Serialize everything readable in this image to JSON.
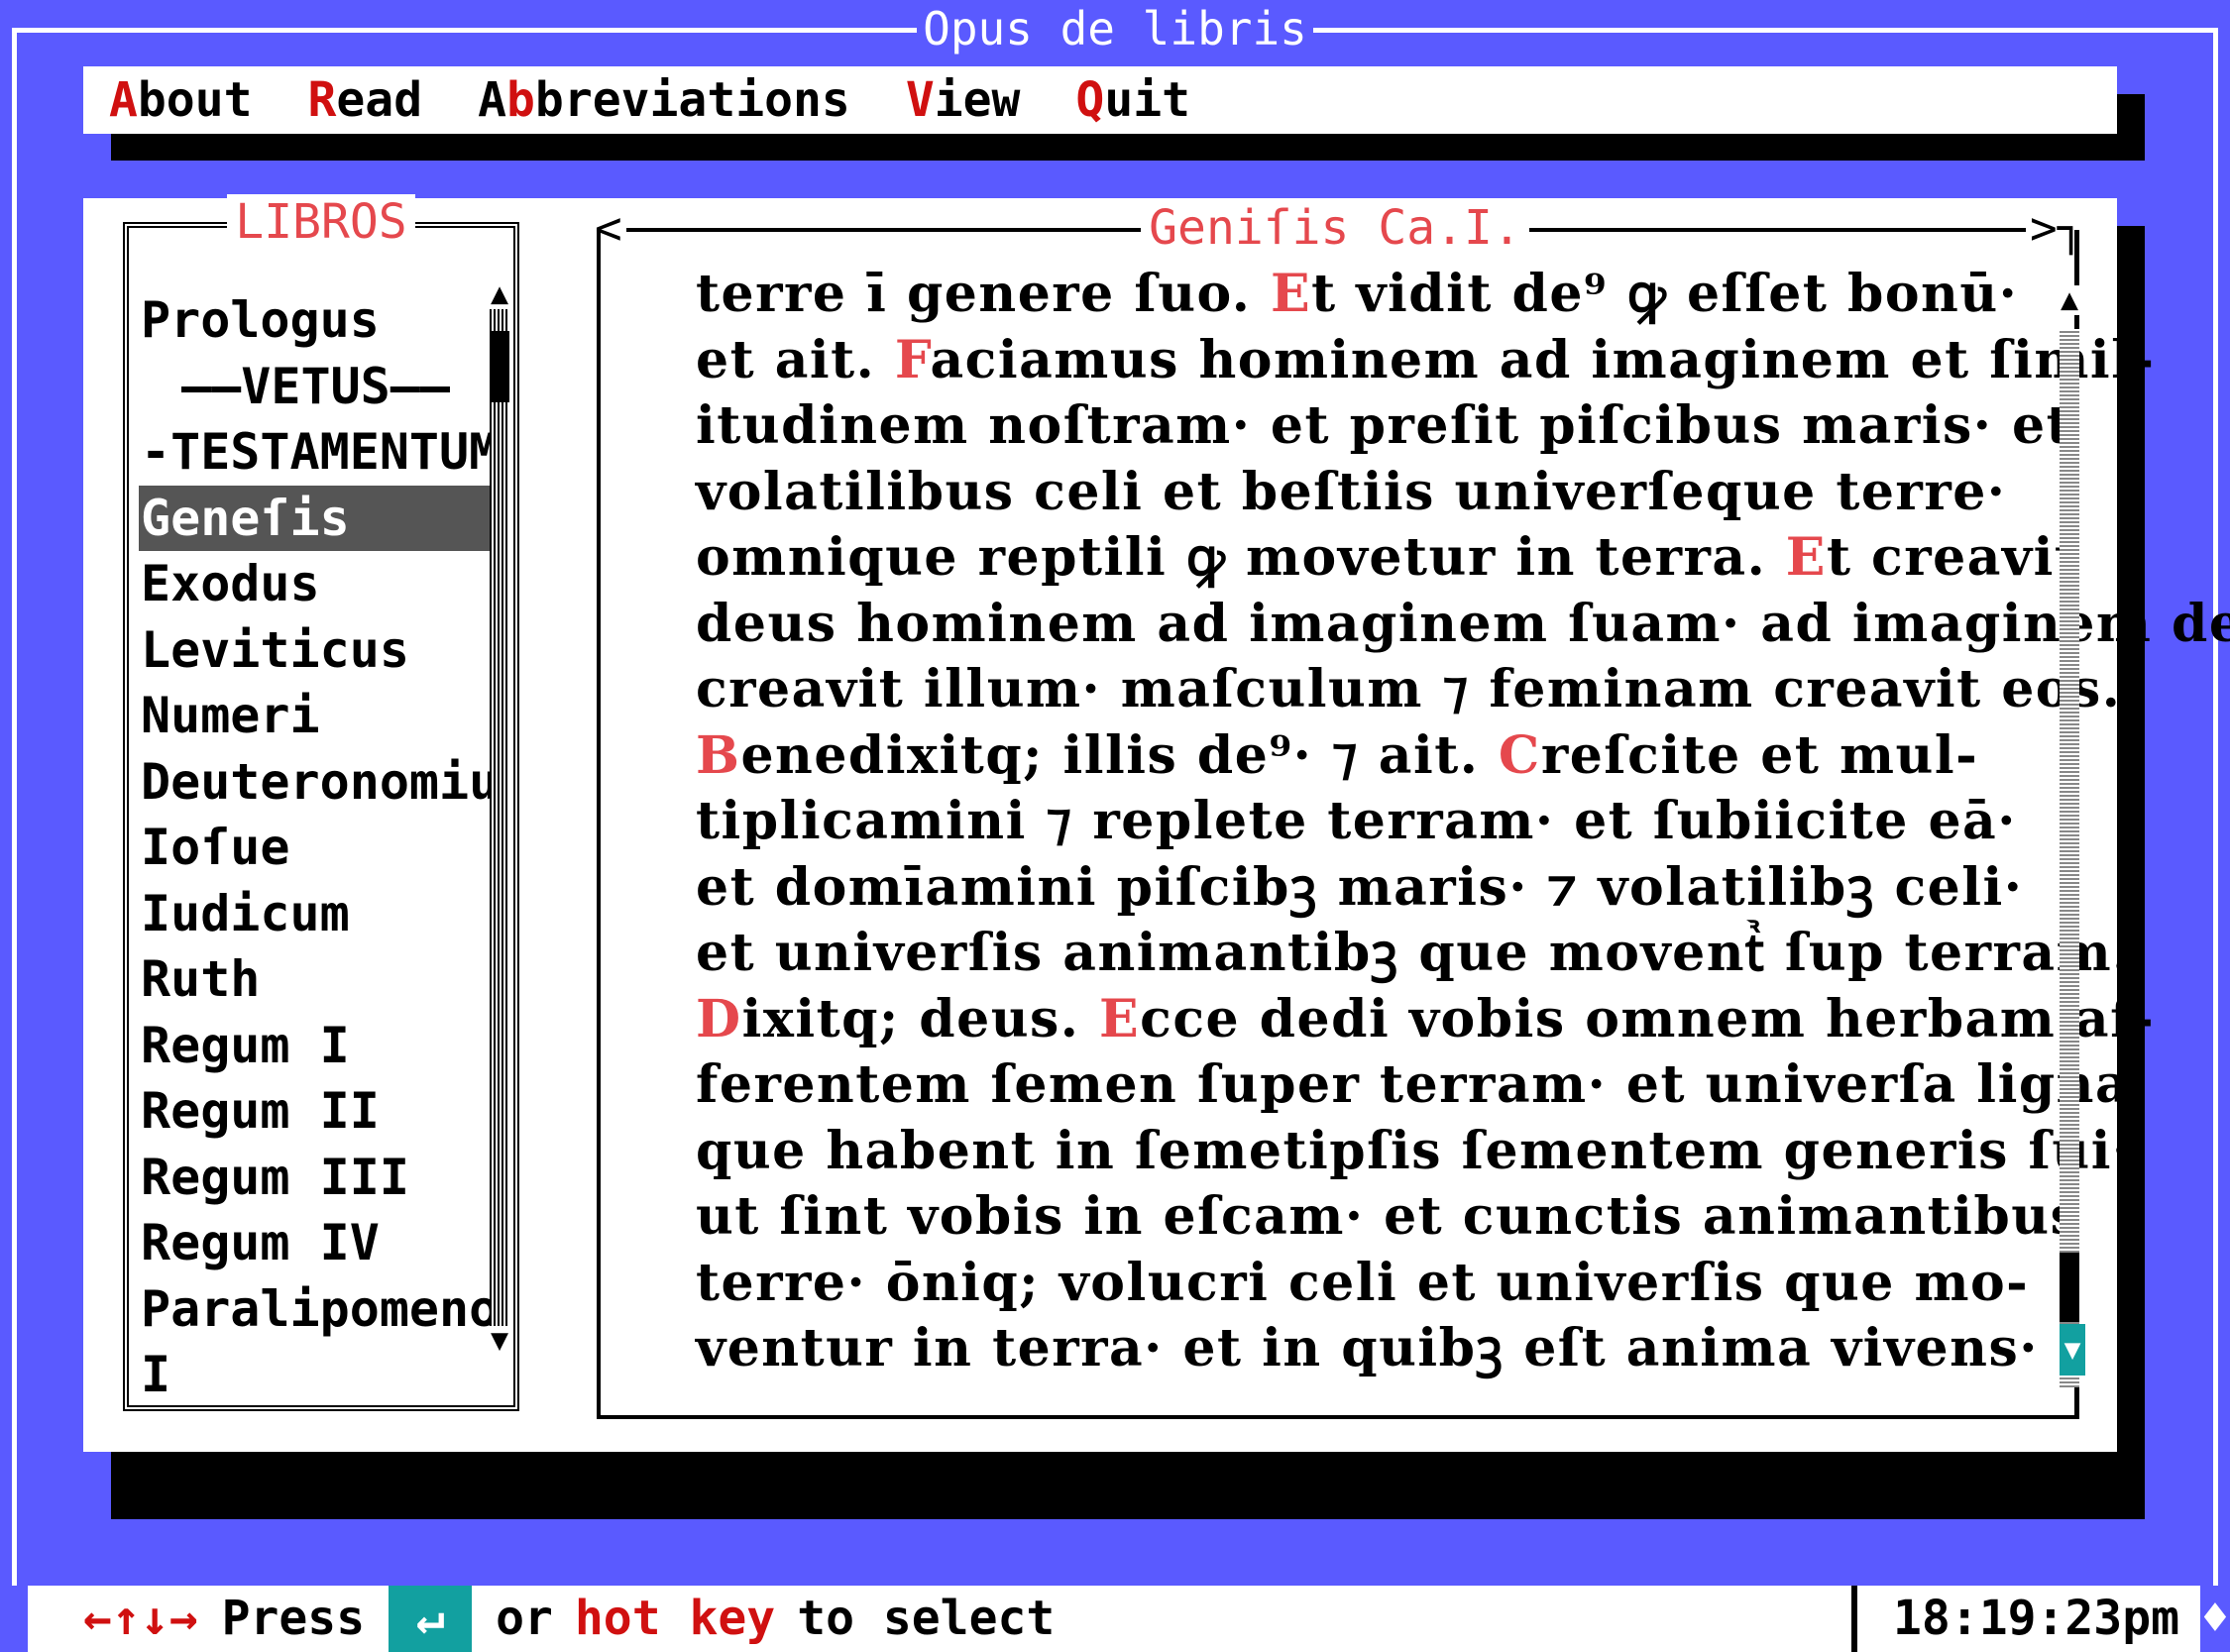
{
  "app_title": "Opus de libris",
  "menu": [
    {
      "hotkey": "A",
      "rest": "bout"
    },
    {
      "hotkey": "R",
      "rest": "ead"
    },
    {
      "prefix": "A",
      "hotkey": "b",
      "rest": "breviations"
    },
    {
      "hotkey": "V",
      "rest": "iew"
    },
    {
      "hotkey": "Q",
      "rest": "uit"
    }
  ],
  "books_panel": {
    "title": "LIBROS",
    "items": [
      {
        "label": "Prologus"
      },
      {
        "label": "——VETUS——",
        "center": true
      },
      {
        "label": "-TESTAMENTUM-",
        "center": true
      },
      {
        "label": "Geneſis",
        "selected": true
      },
      {
        "label": "Exodus"
      },
      {
        "label": "Leviticus"
      },
      {
        "label": "Numeri"
      },
      {
        "label": "Deuteronomium"
      },
      {
        "label": "Ioſue"
      },
      {
        "label": "Iudicum"
      },
      {
        "label": "Ruth"
      },
      {
        "label": "Regum I"
      },
      {
        "label": "Regum II"
      },
      {
        "label": "Regum III"
      },
      {
        "label": "Regum IV"
      },
      {
        "label": "Paralipomenon"
      },
      {
        "label": " I"
      }
    ]
  },
  "text_panel": {
    "title": "Geniſis Ca.I.",
    "lines": [
      [
        {
          "t": "terre ī genere ſuo. "
        },
        {
          "t": "E",
          "cap": true
        },
        {
          "t": "t vidit de⁹ ꝙ eſſet bonū·"
        }
      ],
      [
        {
          "t": "et ait. "
        },
        {
          "t": "F",
          "cap": true
        },
        {
          "t": "aciamus hominem ad imaginem et ſimil-"
        }
      ],
      [
        {
          "t": "itudinem noſtram· et preſit piſcibus maris· et"
        }
      ],
      [
        {
          "t": "volatilibus celi et beſtiis univerſeque terre·"
        }
      ],
      [
        {
          "t": "omnique reptili ꝙ movetur in terra. "
        },
        {
          "t": "E",
          "cap": true
        },
        {
          "t": "t creavit"
        }
      ],
      [
        {
          "t": "deus hominem ad imaginem ſuam· ad imaginem dei"
        }
      ],
      [
        {
          "t": "creavit illum· maſculum ⁊ feminam creavit eos."
        }
      ],
      [
        {
          "t": "B",
          "cap": true
        },
        {
          "t": "enedixitq; illis de⁹· ⁊ ait. "
        },
        {
          "t": "C",
          "cap": true
        },
        {
          "t": "reſcite et mul-"
        }
      ],
      [
        {
          "t": "tiplicamini ⁊ replete terram· et ſubiicite eā·"
        }
      ],
      [
        {
          "t": "et domīamini piſcibꝫ maris· ⁊ volatilibꝫ celi·"
        }
      ],
      [
        {
          "t": "et univerſis animantibꝫ que moventᷣ ſup terram."
        }
      ],
      [
        {
          "t": "D",
          "cap": true
        },
        {
          "t": "ixitq; deus. "
        },
        {
          "t": "E",
          "cap": true
        },
        {
          "t": "cce dedi vobis omnem herbam af-"
        }
      ],
      [
        {
          "t": "ferentem ſemen ſuper terram· et univerſa ligna"
        }
      ],
      [
        {
          "t": "que habent in ſemetipſis ſementem generis ſui·"
        }
      ],
      [
        {
          "t": "ut ſint vobis in eſcam· et cunctis animantibus"
        }
      ],
      [
        {
          "t": "terre· ōniq; volucri celi et univerſis que mo-"
        }
      ],
      [
        {
          "t": "ventur in terra· et in quibꝫ eſt anima vivens·"
        }
      ]
    ]
  },
  "status_bar": {
    "arrows": "←↑↓→",
    "press": "Press",
    "enter_symbol": "↵",
    "or": "or",
    "hot_key": "hot key",
    "to_select": "to select",
    "clock": "18:19:23pm"
  },
  "colors": {
    "background": "#5a5aff",
    "accent_red": "#e5484d",
    "cyan": "#12a0a0"
  }
}
